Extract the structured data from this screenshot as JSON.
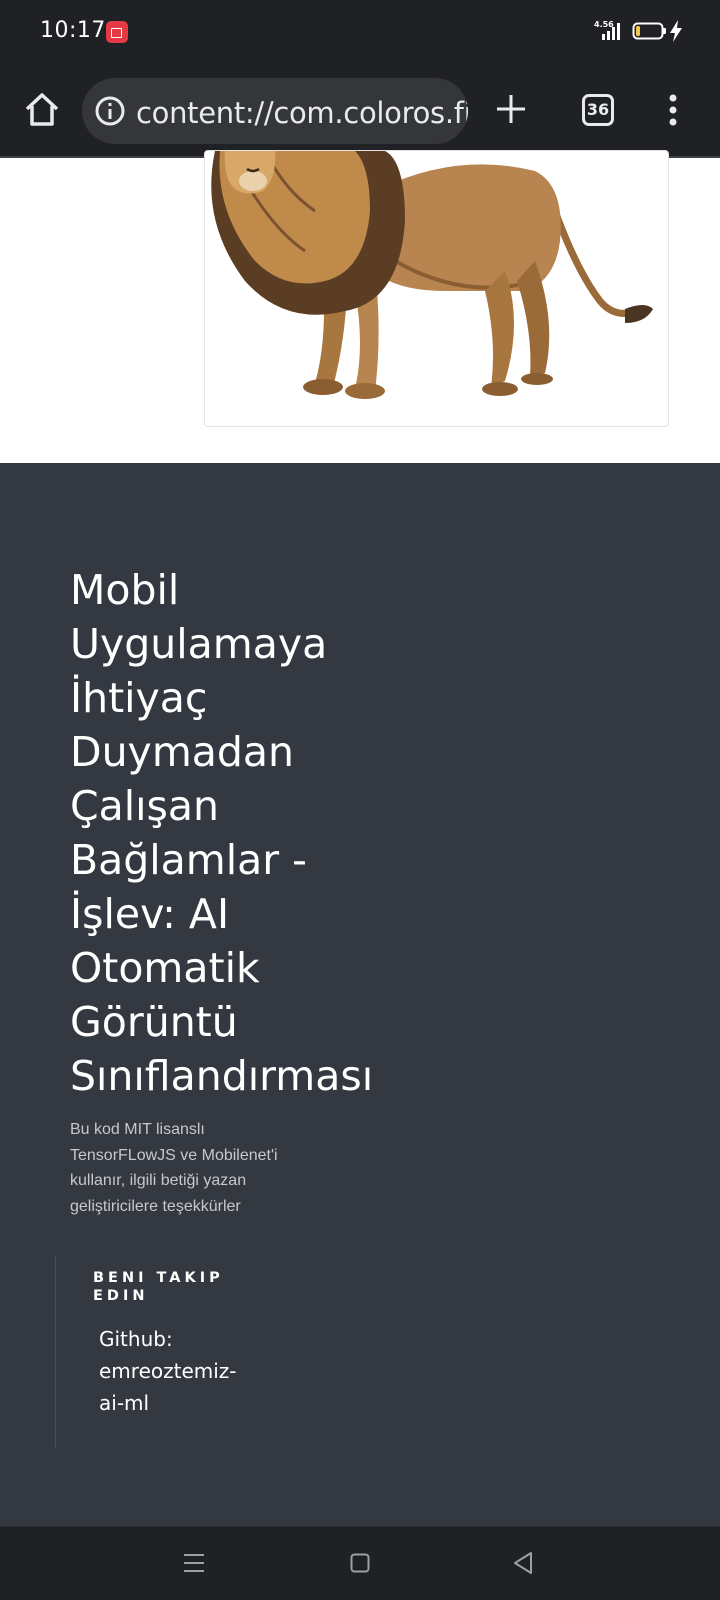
{
  "status_bar": {
    "time": "10:17",
    "network_speed_value": "4.56",
    "icons": [
      "screen-record-icon",
      "signal-icon",
      "battery-icon",
      "charging-icon"
    ]
  },
  "browser": {
    "url": "content://com.coloros.filemanager",
    "tab_count": "36",
    "icons": [
      "home-icon",
      "info-icon",
      "plus-icon",
      "more-vert-icon"
    ]
  },
  "page": {
    "image": {
      "subject": "lion"
    },
    "headline": [
      "Mobil",
      "Uygulamaya",
      "İhtiyaç",
      "Duymadan",
      "Çalışan",
      "Bağlamlar -",
      "İşlev: AI",
      "Otomatik",
      "Görüntü",
      "Sınıflandırması"
    ],
    "credits": [
      "Bu kod MIT lisanslı",
      "TensorFLowJS ve Mobilenet'i",
      "kullanır, ilgili betiği yazan",
      "geliştiricilere teşekkürler"
    ],
    "follow": {
      "heading_lines": [
        "BENI TAKIP",
        "EDIN"
      ],
      "link_lines": [
        "Github:",
        "emreoztemiz-",
        "ai-ml"
      ]
    }
  },
  "colors": {
    "system_bar": "#202124",
    "url_bar": "#35363a",
    "footer_bg": "#343840",
    "text_light": "#ffffff",
    "text_muted": "#c5c8ce",
    "record_badge": "#e53946",
    "battery_level": "#f2c94c"
  },
  "nav_bar": {
    "icons": [
      "recents-icon",
      "home-square-icon",
      "back-triangle-icon"
    ]
  }
}
